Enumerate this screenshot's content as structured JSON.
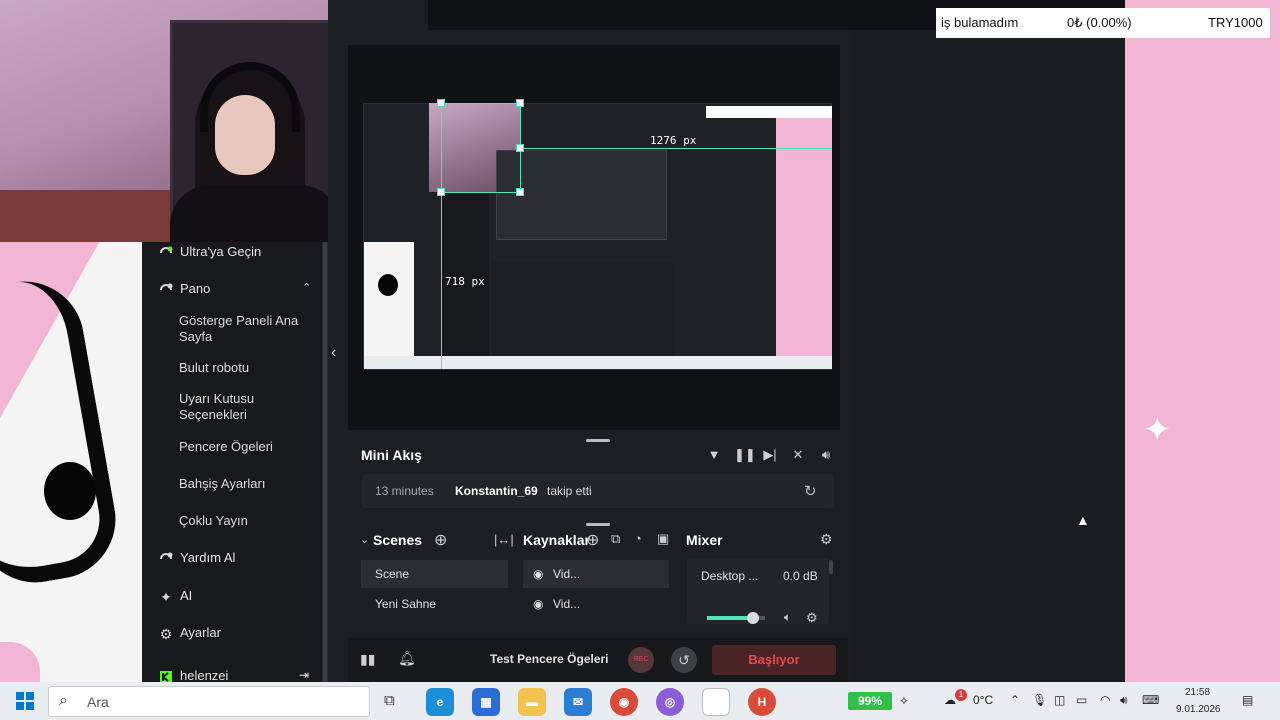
{
  "alert_bar": {
    "left": "iş bulamadım",
    "center": "0₺ (0.00%)",
    "right": "TRY1000"
  },
  "sidebar": {
    "ultra": "Ultra'ya Geçin",
    "pano": "Pano",
    "sub_items": [
      "Gösterge Paneli Ana Sayfa",
      "Bulut robotu",
      "Uyarı Kutusu Seçenekleri",
      "Pencere Ögeleri",
      "Bahşiş Ayarları",
      "Çoklu Yayın"
    ],
    "help": "Yardım Al",
    "ai": "AI",
    "settings": "Ayarlar",
    "user": "helenzei"
  },
  "preview": {
    "width_label": "1276 px",
    "height_label": "718 px"
  },
  "mini_feed": {
    "title": "Mini Akış",
    "event": {
      "time": "13 minutes",
      "user": "Konstantin_69",
      "action": "takip etti"
    }
  },
  "scenes": {
    "title": "Scenes",
    "items": [
      "Scene",
      "Yeni Sahne"
    ]
  },
  "sources": {
    "title": "Kaynaklar",
    "items": [
      "Vid...",
      "Vid..."
    ]
  },
  "mixer": {
    "title": "Mixer",
    "channel": "Desktop ...",
    "level": "0.0 dB",
    "volume_fraction": 0.8
  },
  "bottom_bar": {
    "test_label": "Test Pencere Ögeleri",
    "rec_label": "REC",
    "start_label": "Başlıyor"
  },
  "taskbar": {
    "search_placeholder": "Ara",
    "battery": "99%",
    "weather": "0°C",
    "time": "21:58",
    "date": "9.01.2026",
    "notification_count": "1"
  },
  "colors": {
    "accent_green": "#4ee6b5",
    "pink": "#f2b6d4",
    "start_red": "#e84a4a",
    "sidebar_bg": "#17191c"
  }
}
